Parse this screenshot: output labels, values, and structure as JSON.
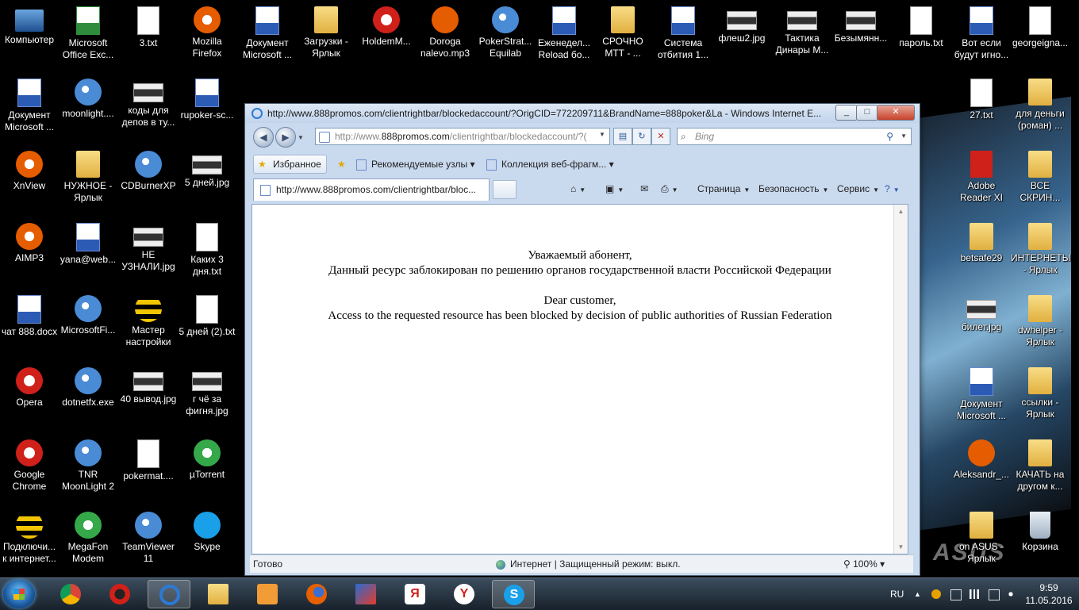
{
  "desktop": {
    "icons": [
      {
        "label": "Компьютер",
        "kind": "pc"
      },
      {
        "label": "Microsoft Office Exc...",
        "kind": "xls"
      },
      {
        "label": "3.txt",
        "kind": "txt"
      },
      {
        "label": "Mozilla Firefox",
        "kind": "orange"
      },
      {
        "label": "Документ Microsoft ...",
        "kind": "doc"
      },
      {
        "label": "Загрузки - Ярлык",
        "kind": "folder"
      },
      {
        "label": "HoldemM...",
        "kind": "red"
      },
      {
        "label": "Doroga nalevo.mp3",
        "kind": "mp3"
      },
      {
        "label": "PokerStrat... Equilab",
        "kind": "app"
      },
      {
        "label": "Еженедел... Reload бо...",
        "kind": "doc"
      },
      {
        "label": "СРОЧНО МТТ - ...",
        "kind": "folder"
      },
      {
        "label": "Система отбития 1...",
        "kind": "doc"
      },
      {
        "label": "флеш2.jpg",
        "kind": "img"
      },
      {
        "label": "Тактика Динары М...",
        "kind": "img"
      },
      {
        "label": "Безымянн...",
        "kind": "img"
      },
      {
        "label": "пароль.txt",
        "kind": "txt"
      },
      {
        "label": "Вот если будут игно...",
        "kind": "doc"
      },
      {
        "label": "georgeigna...",
        "kind": "txt"
      },
      {
        "label": "Документ Microsoft ...",
        "kind": "doc"
      },
      {
        "label": "moonlight....",
        "kind": "app"
      },
      {
        "label": "коды для депов в ту...",
        "kind": "img"
      },
      {
        "label": "rupoker-sc...",
        "kind": "doc"
      },
      {
        "label": "27.txt",
        "kind": "txt"
      },
      {
        "label": "для деньги (роман) ...",
        "kind": "folder"
      },
      {
        "label": "XnView",
        "kind": "orange"
      },
      {
        "label": "НУЖНОЕ - Ярлык",
        "kind": "folder"
      },
      {
        "label": "CDBurnerXP",
        "kind": "app"
      },
      {
        "label": "5 дней.jpg",
        "kind": "img"
      },
      {
        "label": "Adobe Reader XI",
        "kind": "pdf"
      },
      {
        "label": "ВСЕ СКРИН...",
        "kind": "folder"
      },
      {
        "label": "AIMP3",
        "kind": "orange"
      },
      {
        "label": "yana@web...",
        "kind": "doc"
      },
      {
        "label": "НЕ УЗНАЛИ.jpg",
        "kind": "img"
      },
      {
        "label": "Каких 3 дня.txt",
        "kind": "txt"
      },
      {
        "label": "betsafe29",
        "kind": "folder"
      },
      {
        "label": "ИНТЕРНЕТЫ - Ярлык",
        "kind": "folder"
      },
      {
        "label": "чат 888.docx",
        "kind": "doc"
      },
      {
        "label": "MicrosoftFi...",
        "kind": "app"
      },
      {
        "label": "Мастер настройки",
        "kind": "yellow"
      },
      {
        "label": "5 дней (2).txt",
        "kind": "txt"
      },
      {
        "label": "билет.jpg",
        "kind": "img"
      },
      {
        "label": "dwhelper - Ярлык",
        "kind": "folder"
      },
      {
        "label": "Opera",
        "kind": "red"
      },
      {
        "label": "dotnetfx.exe",
        "kind": "app"
      },
      {
        "label": "40 вывод.jpg",
        "kind": "img"
      },
      {
        "label": "г чё за фигня.jpg",
        "kind": "img"
      },
      {
        "label": "Документ Microsoft ...",
        "kind": "doc"
      },
      {
        "label": "ссылки - Ярлык",
        "kind": "folder"
      },
      {
        "label": "Google Chrome",
        "kind": "red"
      },
      {
        "label": "TNR MoonLight 2",
        "kind": "app"
      },
      {
        "label": "pokermat....",
        "kind": "txt"
      },
      {
        "label": "µTorrent",
        "kind": "green"
      },
      {
        "label": "Aleksandr_...",
        "kind": "mp3"
      },
      {
        "label": "КАЧАТЬ на другом к...",
        "kind": "folder"
      },
      {
        "label": "Подключи... к интернет...",
        "kind": "yellow"
      },
      {
        "label": "MegaFon Modem",
        "kind": "green"
      },
      {
        "label": "TeamViewer 11",
        "kind": "app"
      },
      {
        "label": "Skype",
        "kind": "skype"
      },
      {
        "label": "on ASUS - Ярлык",
        "kind": "folder"
      },
      {
        "label": "Корзина",
        "kind": "trash"
      }
    ],
    "wallpaper_logo": "ASUS"
  },
  "browser": {
    "title": "http://www.888promos.com/clientrightbar/blockedaccount/?OrigCID=772209711&BrandName=888poker&La - Windows Internet E...",
    "address_prefix": "http://www.",
    "address_domain": "888promos.com",
    "address_rest": "/clientrightbar/blockedaccount/?(",
    "search_placeholder": "Bing",
    "favorites_label": "Избранное",
    "fav_link1": "Рекомендуемые узлы",
    "fav_link2": "Коллекция веб-фрагм...",
    "tab_title": "http://www.888promos.com/clientrightbar/bloc...",
    "cmd_page": "Страница",
    "cmd_security": "Безопасность",
    "cmd_service": "Сервис",
    "content": {
      "ru_greeting": "Уважаемый абонент,",
      "ru_message": "Данный ресурс заблокирован по решению органов государственной власти Российской Федерации",
      "en_greeting": "Dear customer,",
      "en_message": "Access to the requested resource has been blocked by decision of public authorities of Russian Federation"
    },
    "status": {
      "text": "Готово",
      "zone": "Интернет | Защищенный режим: выкл.",
      "zoom": "100%"
    }
  },
  "taskbar": {
    "language": "RU",
    "time": "9:59",
    "date": "11.05.2016"
  }
}
